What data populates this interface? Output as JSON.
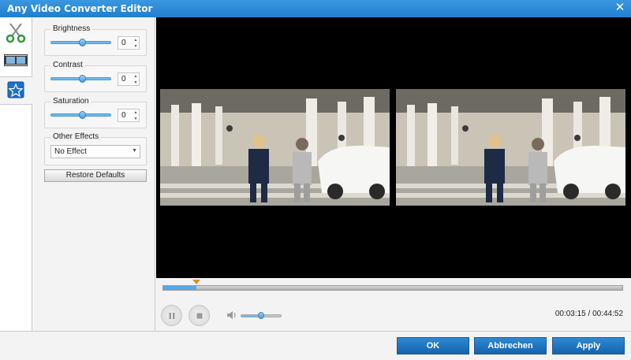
{
  "window": {
    "title": "Any Video Converter Editor",
    "close_icon": "close-icon"
  },
  "tabs": [
    {
      "name": "clip",
      "icon": "scissors-icon"
    },
    {
      "name": "crop",
      "icon": "film-strip-icon"
    },
    {
      "name": "effect",
      "icon": "star-icon",
      "active": true
    }
  ],
  "effects": {
    "brightness": {
      "label": "Brightness",
      "value": "0",
      "level": 0.5
    },
    "contrast": {
      "label": "Contrast",
      "value": "0",
      "level": 0.5
    },
    "saturation": {
      "label": "Saturation",
      "value": "0",
      "level": 0.5
    },
    "other": {
      "label": "Other Effects",
      "selected": "No Effect"
    },
    "restore_label": "Restore Defaults"
  },
  "player": {
    "progress": 0.072,
    "volume": 0.5,
    "time": "00:03:15 / 00:44:52"
  },
  "footer": {
    "ok": "OK",
    "cancel": "Abbrechen",
    "apply": "Apply"
  },
  "colors": {
    "accent": "#1f7fd0",
    "button": "#1f6fb9",
    "marker": "#e08a28"
  }
}
